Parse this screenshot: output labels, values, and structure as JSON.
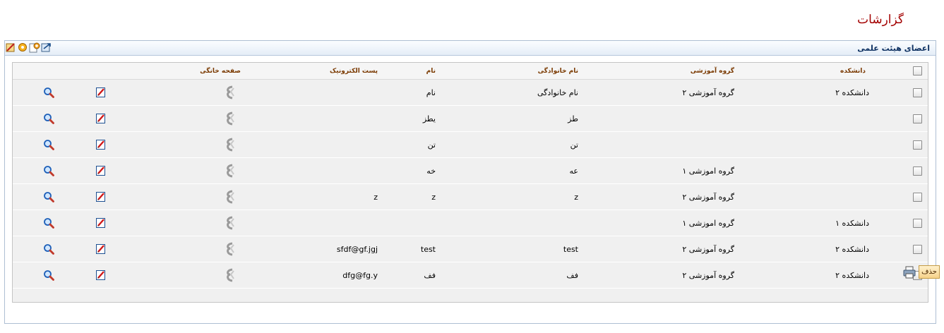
{
  "page": {
    "title": "گزارشات"
  },
  "panel": {
    "title": "اعضای هیئت علمی"
  },
  "toolbar": {
    "icons": [
      "edit-icon",
      "settings-icon",
      "add-icon",
      "export-icon"
    ]
  },
  "table": {
    "headers": {
      "faculty": "دانشکده",
      "group": "گروه آموزشی",
      "lastname": "نام خانوادگی",
      "firstname": "نام",
      "email": "پست الکترونیک",
      "homepage": "صفحه خانگی"
    },
    "rows": [
      {
        "faculty": "دانشکده ۲",
        "group": "گروه آموزشی ۲",
        "lastname": "نام خانوادگی",
        "firstname": "نام",
        "email": ""
      },
      {
        "faculty": "",
        "group": "",
        "lastname": "طز",
        "firstname": "یطز",
        "email": ""
      },
      {
        "faculty": "",
        "group": "",
        "lastname": "تن",
        "firstname": "تن",
        "email": ""
      },
      {
        "faculty": "",
        "group": "گروه اموزشی ۱",
        "lastname": "عه",
        "firstname": "خه",
        "email": ""
      },
      {
        "faculty": "",
        "group": "گروه آموزشی ۲",
        "lastname": "z",
        "firstname": "z",
        "email": "z"
      },
      {
        "faculty": "دانشکده ۱",
        "group": "گروه اموزشی ۱",
        "lastname": "",
        "firstname": "",
        "email": ""
      },
      {
        "faculty": "دانشکده ۲",
        "group": "گروه آموزشی ۲",
        "lastname": "test",
        "firstname": "test",
        "email": "sfdf@gf.jgj"
      },
      {
        "faculty": "دانشکده ۲",
        "group": "گروه آموزشی ۲",
        "lastname": "فف",
        "firstname": "فف",
        "email": "dfg@fg.y"
      }
    ]
  },
  "footer": {
    "delete_label": "حذف"
  }
}
